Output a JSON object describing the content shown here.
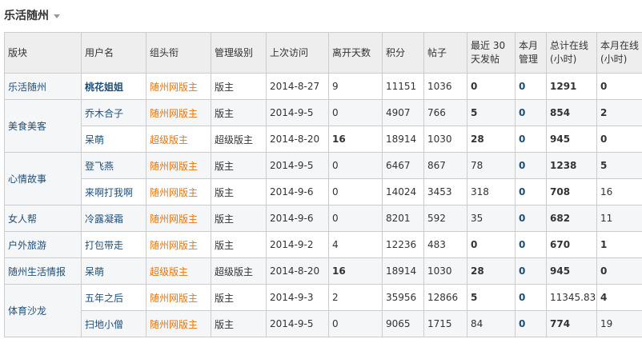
{
  "page": {
    "title": "乐活随州"
  },
  "columns": [
    "版块",
    "用户名",
    "组头衔",
    "管理级别",
    "上次访问",
    "离开天数",
    "积分",
    "帖子",
    "最近 30 天发帖",
    "本月管理",
    "总计在线(小时)",
    "本月在线(小时)"
  ],
  "rows": [
    {
      "board": "乐活随州",
      "user": "桃花姐姐",
      "title": "随州网版主",
      "level": "版主",
      "last_visit": "2014-8-27",
      "days_away": "9",
      "points": "11151",
      "posts": "1036",
      "recent30": "0",
      "month_manage": "0",
      "total_online": "1291",
      "month_online": "0"
    },
    {
      "board": "美食美客",
      "user": "乔木合子",
      "title": "随州网版主",
      "level": "版主",
      "last_visit": "2014-9-5",
      "days_away": "0",
      "points": "4907",
      "posts": "766",
      "recent30": "5",
      "month_manage": "0",
      "total_online": "854",
      "month_online": "2"
    },
    {
      "board": "",
      "user": "呆萌",
      "title": "超级版主",
      "level": "超级版主",
      "last_visit": "2014-8-20",
      "days_away": "16",
      "points": "18914",
      "posts": "1030",
      "recent30": "28",
      "month_manage": "0",
      "total_online": "945",
      "month_online": "0"
    },
    {
      "board": "心情故事",
      "user": "登飞燕",
      "title": "随州网版主",
      "level": "版主",
      "last_visit": "2014-9-5",
      "days_away": "0",
      "points": "6467",
      "posts": "867",
      "recent30": "78",
      "month_manage": "0",
      "total_online": "1238",
      "month_online": "5"
    },
    {
      "board": "",
      "user": "来啊打我啊",
      "title": "随州网版主",
      "level": "版主",
      "last_visit": "2014-9-6",
      "days_away": "0",
      "points": "14024",
      "posts": "3453",
      "recent30": "318",
      "month_manage": "0",
      "total_online": "708",
      "month_online": "16"
    },
    {
      "board": "女人帮",
      "user": "冷露凝霜",
      "title": "随州网版主",
      "level": "版主",
      "last_visit": "2014-9-6",
      "days_away": "0",
      "points": "8201",
      "posts": "592",
      "recent30": "35",
      "month_manage": "0",
      "total_online": "682",
      "month_online": "11"
    },
    {
      "board": "户外旅游",
      "user": "打包带走",
      "title": "随州网版主",
      "level": "版主",
      "last_visit": "2014-9-2",
      "days_away": "4",
      "points": "12236",
      "posts": "483",
      "recent30": "0",
      "month_manage": "0",
      "total_online": "670",
      "month_online": "1"
    },
    {
      "board": "随州生活情报",
      "user": "呆萌",
      "title": "超级版主",
      "level": "超级版主",
      "last_visit": "2014-8-20",
      "days_away": "16",
      "points": "18914",
      "posts": "1030",
      "recent30": "28",
      "month_manage": "0",
      "total_online": "945",
      "month_online": "0"
    },
    {
      "board": "体育沙龙",
      "user": "五年之后",
      "title": "随州网版主",
      "level": "版主",
      "last_visit": "2014-9-3",
      "days_away": "2",
      "points": "35956",
      "posts": "12866",
      "recent30": "5",
      "month_manage": "0",
      "total_online": "11345.83",
      "month_online": "4"
    },
    {
      "board": "",
      "user": "扫地小僧",
      "title": "随州网版主",
      "level": "版主",
      "last_visit": "2014-9-5",
      "days_away": "0",
      "points": "9065",
      "posts": "1715",
      "recent30": "84",
      "month_manage": "0",
      "total_online": "774",
      "month_online": "19"
    }
  ],
  "colors": {
    "header_bg": "#eeeeee",
    "border": "#cccccc",
    "link_blue": "#1f4e79",
    "title_orange": "#e5760f",
    "row_alt": "#f4f6f8"
  }
}
